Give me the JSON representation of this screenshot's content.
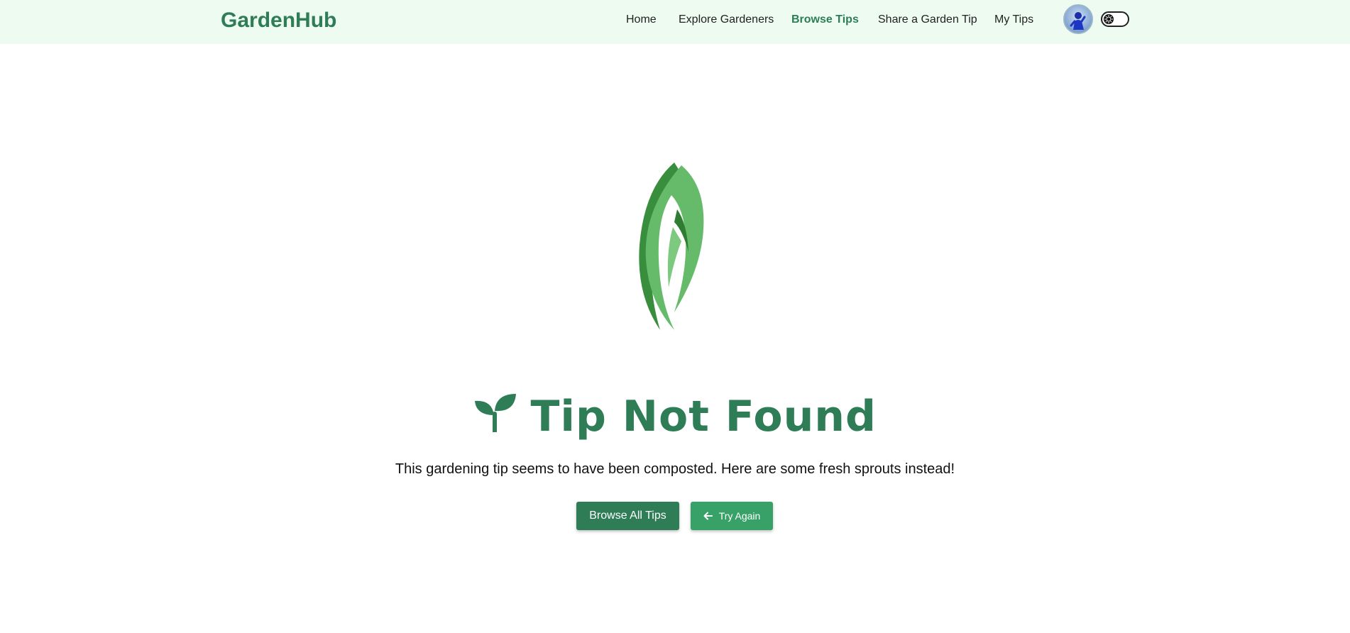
{
  "navbar": {
    "brand": "GardenHub",
    "links": [
      {
        "label": "Home",
        "active": false
      },
      {
        "label": "Explore Gardeners",
        "active": false
      },
      {
        "label": "Browse Tips",
        "active": true
      },
      {
        "label": "Share a Garden Tip",
        "active": false
      },
      {
        "label": "My Tips",
        "active": false
      }
    ],
    "avatar_icon": "user-avatar",
    "theme_toggle_icon": "theme-toggle-icon"
  },
  "main": {
    "hero_icon": "leaf-icon",
    "title_icon": "sprout-icon",
    "title": "Tip Not Found",
    "subtitle": "This gardening tip seems to have been composted. Here are some fresh sprouts instead!",
    "buttons": {
      "browse_label": "Browse All Tips",
      "try_again_label": "Try Again",
      "try_again_icon": "arrow-left-icon"
    }
  },
  "colors": {
    "brand": "#2e7d57",
    "navbar_bg": "#edfbf1",
    "button_primary": "#2e7d57",
    "button_secondary": "#38a168",
    "leaf_light": "#66bb6a",
    "leaf_dark": "#388e3c"
  }
}
